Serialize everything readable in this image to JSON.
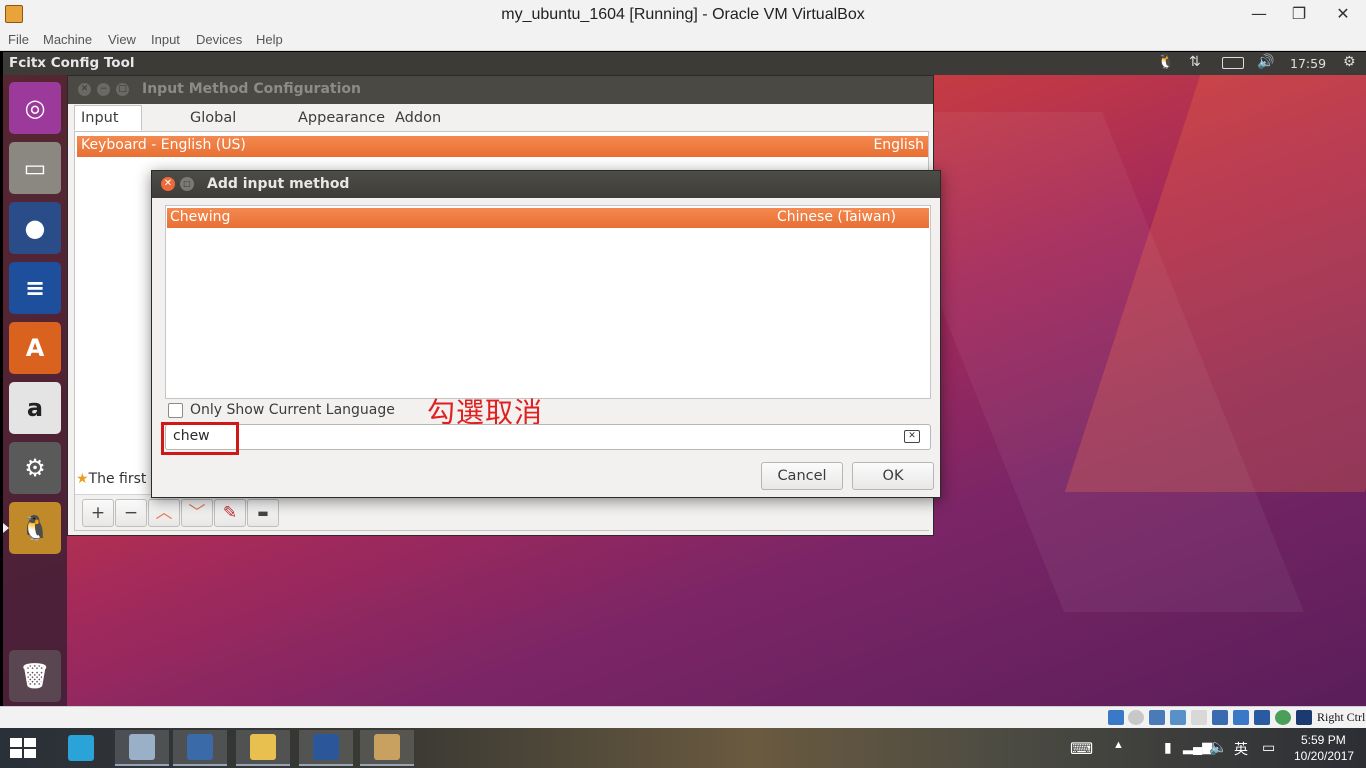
{
  "host_window": {
    "title": "my_ubuntu_1604 [Running] - Oracle VM VirtualBox",
    "minimize_label": "—",
    "maximize_label": "❐",
    "close_label": "✕",
    "menu": [
      "File",
      "Machine",
      "View",
      "Input",
      "Devices",
      "Help"
    ]
  },
  "guest_topbar": {
    "app_title": "Fcitx Config Tool",
    "clock": "17:59",
    "indicators": [
      "tux-icon",
      "network-icon",
      "battery-icon",
      "volume-icon",
      "gear-icon"
    ]
  },
  "launcher": {
    "items": [
      "ubuntu-dash",
      "files",
      "firefox",
      "libreoffice-writer",
      "software-center",
      "amazon",
      "system-settings",
      "fcitx"
    ],
    "trash": "trash"
  },
  "fcitx_window": {
    "title": "Input Method Configuration",
    "tabs": [
      "Input Method",
      "Global Config",
      "Appearance",
      "Addon"
    ],
    "active_tab": "Input Method",
    "selected_row": {
      "name": "Keyboard - English (US)",
      "language": "English"
    },
    "hint_text": "The first",
    "toolbar": {
      "add": "+",
      "remove": "−",
      "up": "︿",
      "down": "﹀"
    }
  },
  "add_dialog": {
    "title": "Add input method",
    "selected_row": {
      "name": "Chewing",
      "language": "Chinese (Taiwan)"
    },
    "only_current_language_label": "Only Show Current Language",
    "only_current_language_checked": false,
    "search_value": "chew",
    "annotation": "勾選取消",
    "cancel_label": "Cancel",
    "ok_label": "OK"
  },
  "host_statusbar": {
    "right_ctrl": "Right Ctrl"
  },
  "taskbar": {
    "time": "5:59 PM",
    "date": "10/20/2017",
    "ime": "英",
    "colors": {
      "annotation": "#e02020",
      "selection": "#e86f33"
    }
  }
}
